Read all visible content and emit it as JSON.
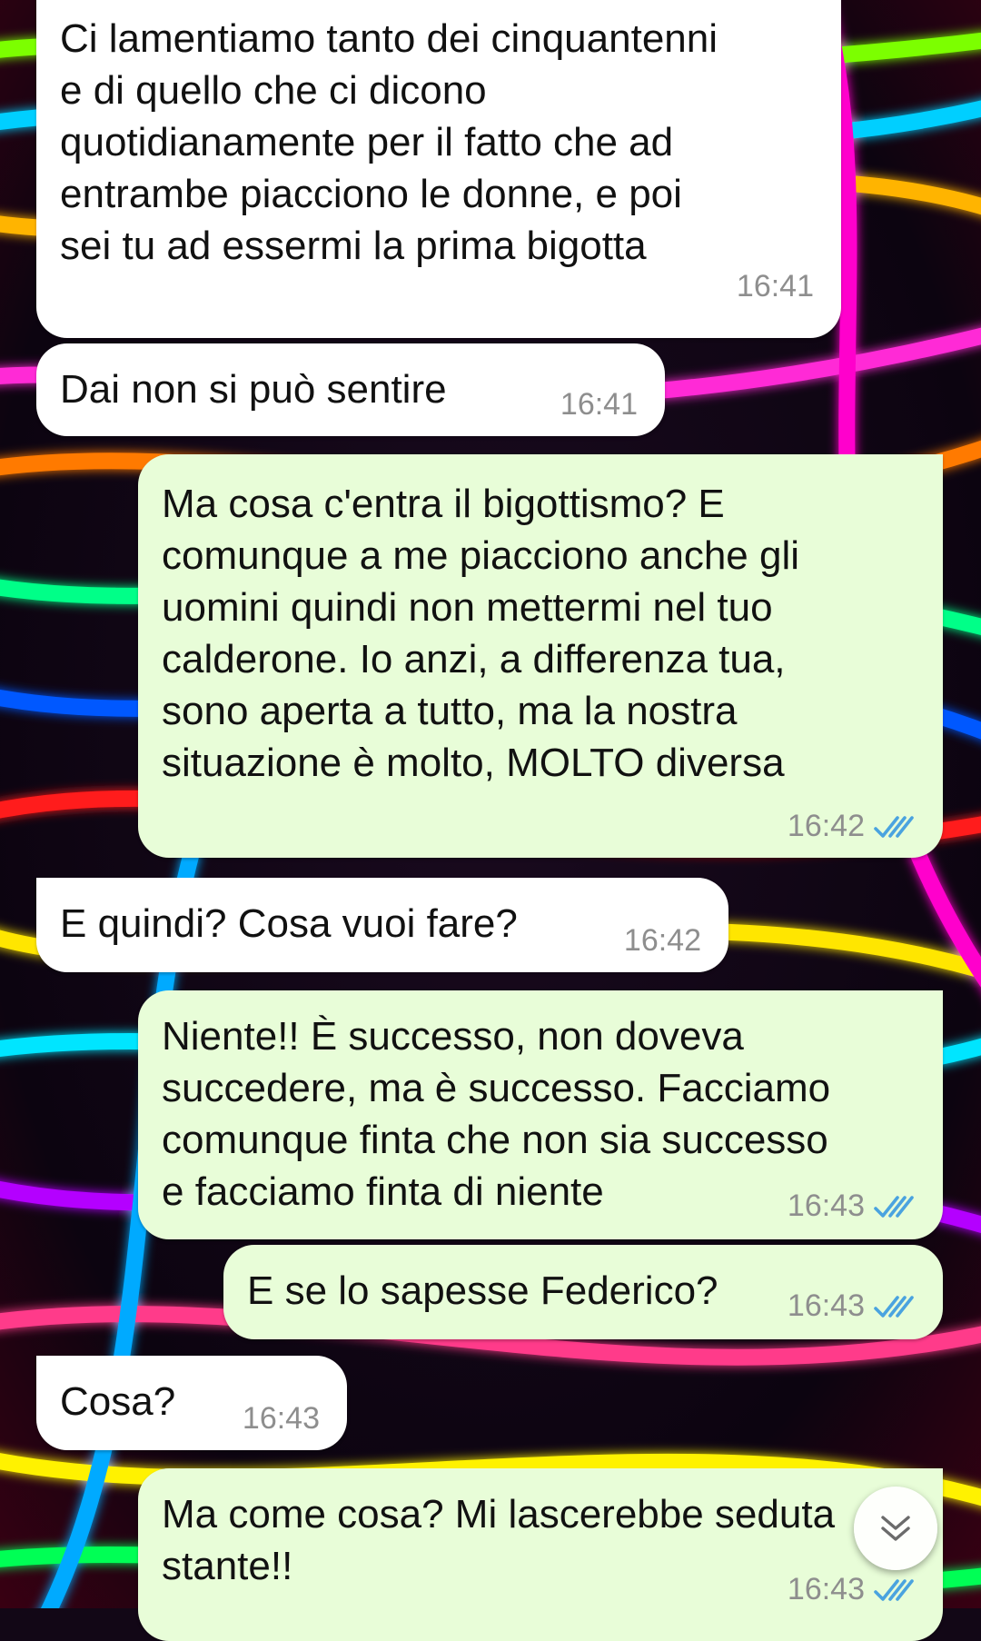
{
  "colors": {
    "incoming_bubble": "#ffffff",
    "outgoing_bubble": "#e8fdd8",
    "text": "#111111",
    "timestamp": "#8e8e8e",
    "read_receipt": "#4aa3df"
  },
  "background": {
    "description_icon": "rainbow-neon-wallpaper"
  },
  "messages": [
    {
      "direction": "incoming",
      "text": "Ci lamentiamo tanto dei cinquantenni\ne di quello che ci dicono\nquotidianamente per il fatto che ad\nentrambe piacciono le donne, e poi\nsei tu ad essermi la prima bigotta",
      "time": "16:41"
    },
    {
      "direction": "incoming",
      "text": "Dai non si può sentire",
      "time": "16:41"
    },
    {
      "direction": "outgoing",
      "text": "Ma cosa c'entra il bigottismo? E\ncomunque a me piacciono anche gli\nuomini quindi non mettermi nel tuo\ncalderone. Io anzi, a differenza tua,\nsono aperta a tutto, ma la nostra\nsituazione è molto, MOLTO diversa",
      "time": "16:42",
      "status_icon": "double-check-read-icon"
    },
    {
      "direction": "incoming",
      "text": "E quindi? Cosa vuoi fare?",
      "time": "16:42"
    },
    {
      "direction": "outgoing",
      "text": "Niente!! È successo, non doveva\nsuccedere, ma è successo. Facciamo\ncomunque finta che non sia successo\ne facciamo finta di niente",
      "time": "16:43",
      "status_icon": "double-check-read-icon"
    },
    {
      "direction": "outgoing",
      "text": "E se lo sapesse Federico?",
      "time": "16:43",
      "status_icon": "double-check-read-icon"
    },
    {
      "direction": "incoming",
      "text": "Cosa?",
      "time": "16:43"
    },
    {
      "direction": "outgoing",
      "text": "Ma come cosa? Mi lascerebbe seduta\nstante!!",
      "time": "16:43",
      "status_icon": "double-check-read-icon"
    }
  ],
  "scroll_button": {
    "icon": "chevron-down-icon"
  }
}
